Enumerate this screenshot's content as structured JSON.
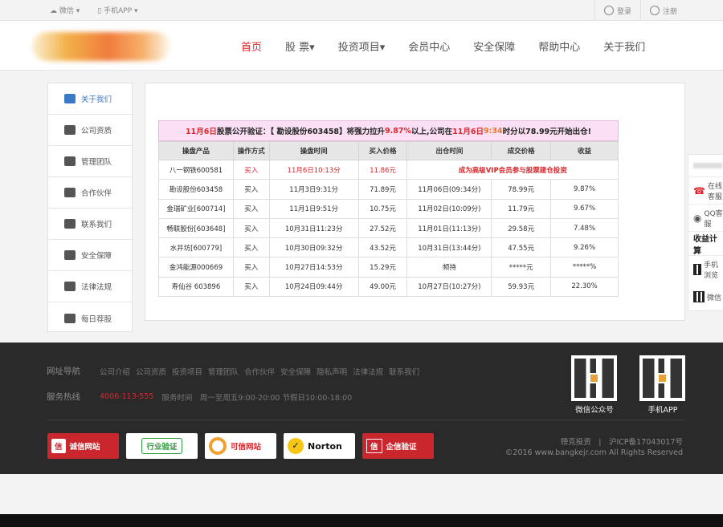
{
  "topbar": {
    "wechat": "微信",
    "app": "手机APP",
    "login": "登录",
    "register": "注册"
  },
  "nav": {
    "items": [
      "首页",
      "股 票▾",
      "投资项目▾",
      "会员中心",
      "安全保障",
      "帮助中心",
      "关于我们"
    ]
  },
  "sidebar": {
    "items": [
      "关于我们",
      "公司资质",
      "管理团队",
      "合作伙伴",
      "联系我们",
      "安全保障",
      "法律法规",
      "每日荐股"
    ]
  },
  "notice": {
    "p1": "11月6日",
    "p2": "股票公开验证：【 勘设股份603458】将强力拉升",
    "p3": "9.87%",
    "p4": " 以上,公司在",
    "p5": "11月6日",
    "p6": "9:34",
    "p7": "时分以78.99元开始出仓!"
  },
  "table": {
    "headers": [
      "操盘产品",
      "操作方式",
      "操盘时间",
      "买入价格",
      "出仓时间",
      "成交价格",
      "收益"
    ],
    "row0": [
      "八一钢铁600581",
      "买入",
      "11月6日10:13分",
      "11.86元",
      "成为高级VIP会员参与股票建仓投资"
    ],
    "rows": [
      [
        "勘设股份603458",
        "买入",
        "11月3日9:31分",
        "71.89元",
        "11月06日(09:34分)",
        "78.99元",
        "9.87%"
      ],
      [
        "金瑞矿业[600714]",
        "买入",
        "11月1日9:51分",
        "10.75元",
        "11月02日(10:09分)",
        "11.79元",
        "9.67%"
      ],
      [
        "畅联股份[603648]",
        "买入",
        "10月31日11:23分",
        "27.52元",
        "11月01日(11:13分)",
        "29.58元",
        "7.48%"
      ],
      [
        "水井坊[600779]",
        "买入",
        "10月30日09:32分",
        "43.52元",
        "10月31日(13:44分)",
        "47.55元",
        "9.26%"
      ],
      [
        "金鸿能源000669",
        "买入",
        "10月27日14:53分",
        "15.29元",
        "频持",
        "*****元",
        "*****%"
      ],
      [
        "寿仙谷 603896",
        "买入",
        "10月24日09:44分",
        "49.00元",
        "10月27日(10:27分)",
        "59.93元",
        "22.30%"
      ]
    ]
  },
  "float": {
    "online": "在线客服",
    "qq": "QQ客服",
    "calc": "收益计算",
    "phone": "手机浏览",
    "wechat": "微信"
  },
  "footer": {
    "nav_label": "网址导航",
    "links": [
      "公司介绍",
      "公司资质",
      "投资项目",
      "管理团队",
      "合作伙伴",
      "安全保障",
      "隐私声明",
      "法律法规",
      "联系我们"
    ],
    "hotline_label": "服务热线",
    "hotline": "4006-113-555",
    "hours": "服务时间　周一至周五9:00-20:00 节假日10:00-18:00",
    "qr1": "微信公众号",
    "qr2": "手机APP",
    "badges": [
      "诚信网站",
      "行业验证",
      "可信网站",
      "Norton",
      "企信验证"
    ],
    "icp": "镑克投资　|　沪ICP备17043017号",
    "copyright": "©2016 www.bangkejr.com All Rights Reserved"
  }
}
